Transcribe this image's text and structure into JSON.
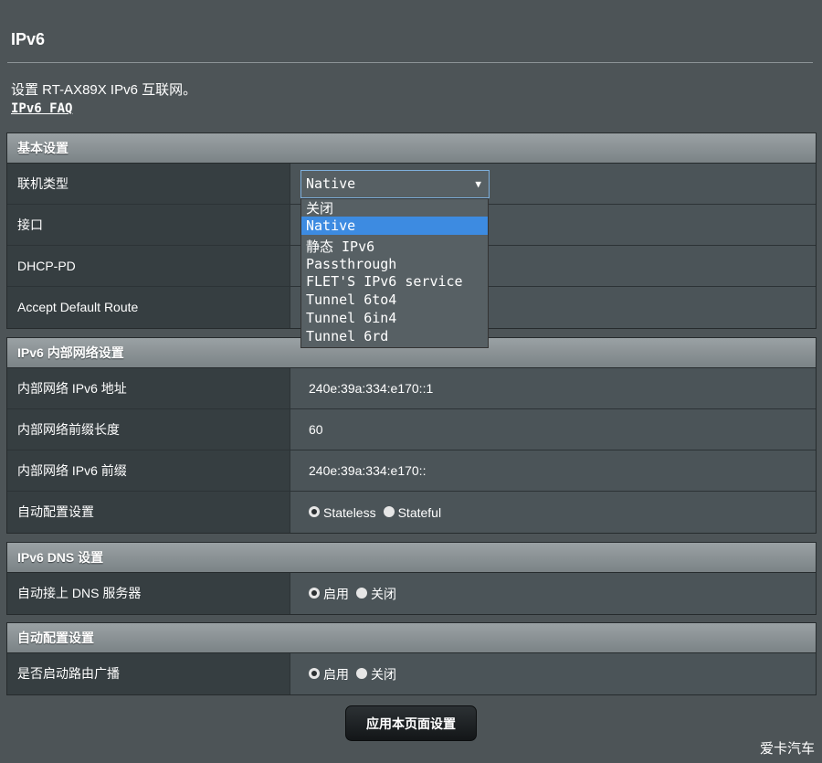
{
  "page": {
    "title": "IPv6",
    "description": "设置 RT-AX89X IPv6 互联网。",
    "faq_link": "IPv6 FAQ",
    "watermark": "爱卡汽车"
  },
  "basic": {
    "header": "基本设置",
    "connection_type": {
      "label": "联机类型",
      "selected": "Native",
      "options": [
        "关闭",
        "Native",
        "静态 IPv6",
        "Passthrough",
        "FLET'S IPv6 service",
        "Tunnel 6to4",
        "Tunnel 6in4",
        "Tunnel 6rd"
      ]
    },
    "interface": {
      "label": "接口"
    },
    "dhcp_pd": {
      "label": "DHCP-PD"
    },
    "accept_default_route": {
      "label": "Accept Default Route"
    }
  },
  "lan": {
    "header": "IPv6 内部网络设置",
    "address": {
      "label": "内部网络 IPv6 地址",
      "value": "240e:39a:334:e170::1"
    },
    "prefix_length": {
      "label": "内部网络前缀长度",
      "value": "60"
    },
    "prefix": {
      "label": "内部网络 IPv6 前缀",
      "value": "240e:39a:334:e170::"
    },
    "autoconf": {
      "label": "自动配置设置",
      "option_stateless": "Stateless",
      "option_stateful": "Stateful",
      "selected": "Stateless"
    }
  },
  "dns": {
    "header": "IPv6 DNS 设置",
    "auto_dns": {
      "label": "自动接上 DNS 服务器",
      "option_on": "启用",
      "option_off": "关闭",
      "selected": "启用"
    }
  },
  "autoconf": {
    "header": "自动配置设置",
    "router_advert": {
      "label": "是否启动路由广播",
      "option_on": "启用",
      "option_off": "关闭",
      "selected": "启用"
    }
  },
  "actions": {
    "apply": "应用本页面设置"
  }
}
